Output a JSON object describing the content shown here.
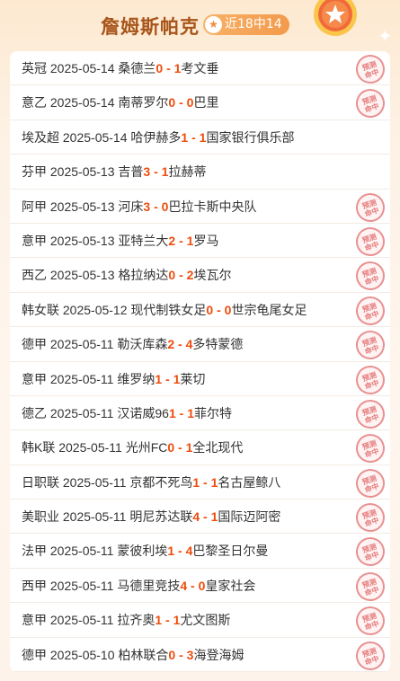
{
  "header": {
    "title": "詹姆斯帕克",
    "record": "近18中14",
    "record_icon": "star-icon"
  },
  "stamp_text": [
    "预测",
    "命中"
  ],
  "matches": [
    {
      "league": "英冠",
      "date": "2025-05-14",
      "home": "桑德兰",
      "hs": "0",
      "as": "1",
      "away": "考文垂",
      "hit": true
    },
    {
      "league": "意乙",
      "date": "2025-05-14",
      "home": "南蒂罗尔",
      "hs": "0",
      "as": "0",
      "away": "巴里",
      "hit": true
    },
    {
      "league": "埃及超",
      "date": "2025-05-14",
      "home": "哈伊赫多",
      "hs": "1",
      "as": "1",
      "away": "国家银行俱乐部",
      "hit": false
    },
    {
      "league": "芬甲",
      "date": "2025-05-13",
      "home": "吉普",
      "hs": "3",
      "as": "1",
      "away": "拉赫蒂",
      "hit": false
    },
    {
      "league": "阿甲",
      "date": "2025-05-13",
      "home": "河床",
      "hs": "3",
      "as": "0",
      "away": "巴拉卡斯中央队",
      "hit": true
    },
    {
      "league": "意甲",
      "date": "2025-05-13",
      "home": "亚特兰大",
      "hs": "2",
      "as": "1",
      "away": "罗马",
      "hit": true
    },
    {
      "league": "西乙",
      "date": "2025-05-13",
      "home": "格拉纳达",
      "hs": "0",
      "as": "2",
      "away": "埃瓦尔",
      "hit": true
    },
    {
      "league": "韩女联",
      "date": "2025-05-12",
      "home": "现代制铁女足",
      "hs": "0",
      "as": "0",
      "away": "世宗龟尾女足",
      "hit": true
    },
    {
      "league": "德甲",
      "date": "2025-05-11",
      "home": "勒沃库森",
      "hs": "2",
      "as": "4",
      "away": "多特蒙德",
      "hit": true
    },
    {
      "league": "意甲",
      "date": "2025-05-11",
      "home": "维罗纳",
      "hs": "1",
      "as": "1",
      "away": "莱切",
      "hit": true
    },
    {
      "league": "德乙",
      "date": "2025-05-11",
      "home": "汉诺威96",
      "hs": "1",
      "as": "1",
      "away": "菲尔特",
      "hit": true
    },
    {
      "league": "韩K联",
      "date": "2025-05-11",
      "home": "光州FC",
      "hs": "0",
      "as": "1",
      "away": "全北现代",
      "hit": true
    },
    {
      "league": "日职联",
      "date": "2025-05-11",
      "home": "京都不死鸟",
      "hs": "1",
      "as": "1",
      "away": "名古屋鲸八",
      "hit": true
    },
    {
      "league": "美职业",
      "date": "2025-05-11",
      "home": "明尼苏达联",
      "hs": "4",
      "as": "1",
      "away": "国际迈阿密",
      "hit": true
    },
    {
      "league": "法甲",
      "date": "2025-05-11",
      "home": "蒙彼利埃",
      "hs": "1",
      "as": "4",
      "away": "巴黎圣日尔曼",
      "hit": true
    },
    {
      "league": "西甲",
      "date": "2025-05-11",
      "home": "马德里竞技",
      "hs": "4",
      "as": "0",
      "away": "皇家社会",
      "hit": true
    },
    {
      "league": "意甲",
      "date": "2025-05-11",
      "home": "拉齐奥",
      "hs": "1",
      "as": "1",
      "away": "尤文图斯",
      "hit": true
    },
    {
      "league": "德甲",
      "date": "2025-05-10",
      "home": "柏林联合",
      "hs": "0",
      "as": "3",
      "away": "海登海姆",
      "hit": true
    }
  ]
}
